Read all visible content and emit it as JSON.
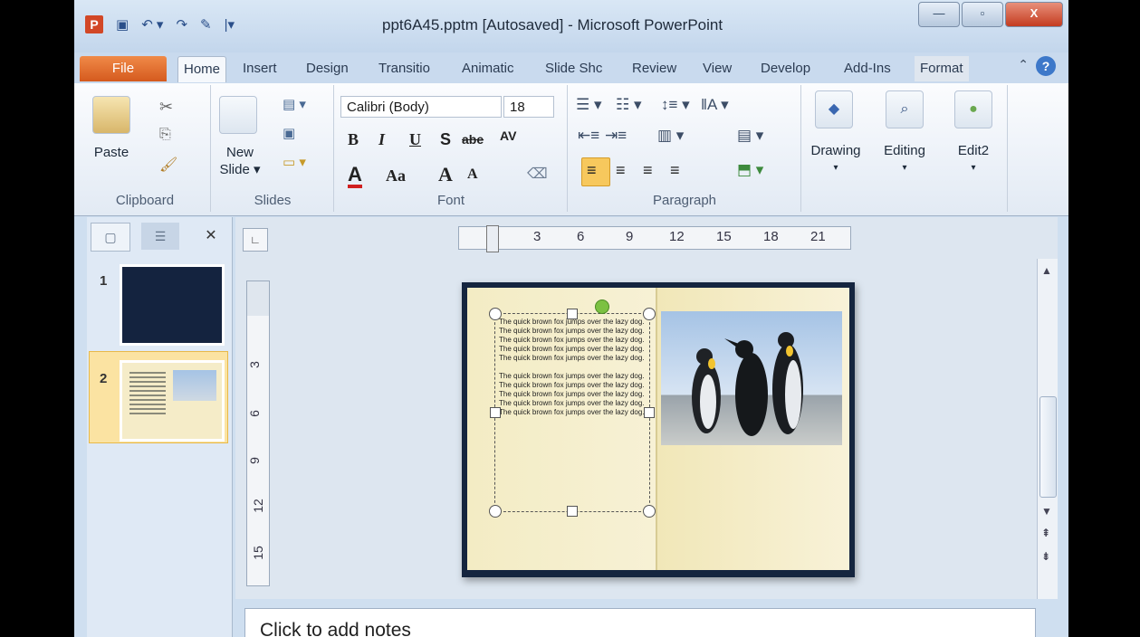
{
  "window": {
    "title": "ppt6A45.pptm [Autosaved] - Microsoft PowerPoint",
    "controls": {
      "minimize": "—",
      "maximize": "▫",
      "close": "X"
    }
  },
  "tabs": [
    "File",
    "Home",
    "Insert",
    "Design",
    "Transitio",
    "Animatic",
    "Slide Shc",
    "Review",
    "View",
    "Develop",
    "Add-Ins",
    "Format"
  ],
  "ribbon": {
    "clipboard": {
      "label": "Clipboard",
      "paste": "Paste"
    },
    "slides": {
      "label": "Slides",
      "new_slide_1": "New",
      "new_slide_2": "Slide ▾"
    },
    "font": {
      "label": "Font",
      "family": "Calibri (Body)",
      "size": "18",
      "bold": "B",
      "italic": "I",
      "underline": "U",
      "shadow": "S",
      "strike": "abe",
      "spacing": "AV",
      "aa": "Aa",
      "grow": "A",
      "shrink": "A",
      "color": "A"
    },
    "paragraph": {
      "label": "Paragraph"
    },
    "drawing": {
      "label": "Drawing"
    },
    "editing": {
      "label": "Editing"
    },
    "edit2": {
      "label": "Edit2"
    }
  },
  "ruler": {
    "h_ticks": [
      "3",
      "6",
      "9",
      "12",
      "15",
      "18",
      "21"
    ],
    "v_ticks": [
      "3",
      "6",
      "9",
      "12",
      "15"
    ]
  },
  "slides_pane": {
    "thumb_numbers": [
      "1",
      "2"
    ],
    "close": "✕"
  },
  "slide": {
    "paragraph_1": "The quick brown fox jumps over the lazy dog. The quick brown fox jumps over the lazy dog. The quick brown fox jumps over the lazy dog. The quick brown fox jumps over the lazy dog. The quick brown fox jumps over the lazy dog.",
    "paragraph_2": "The quick brown fox jumps over the lazy dog. The quick brown fox jumps over the lazy dog. The quick brown fox jumps over the lazy dog. The quick brown fox jumps over the lazy dog. The quick brown fox jumps over the lazy dog."
  },
  "notes": {
    "placeholder": "Click to add notes"
  }
}
